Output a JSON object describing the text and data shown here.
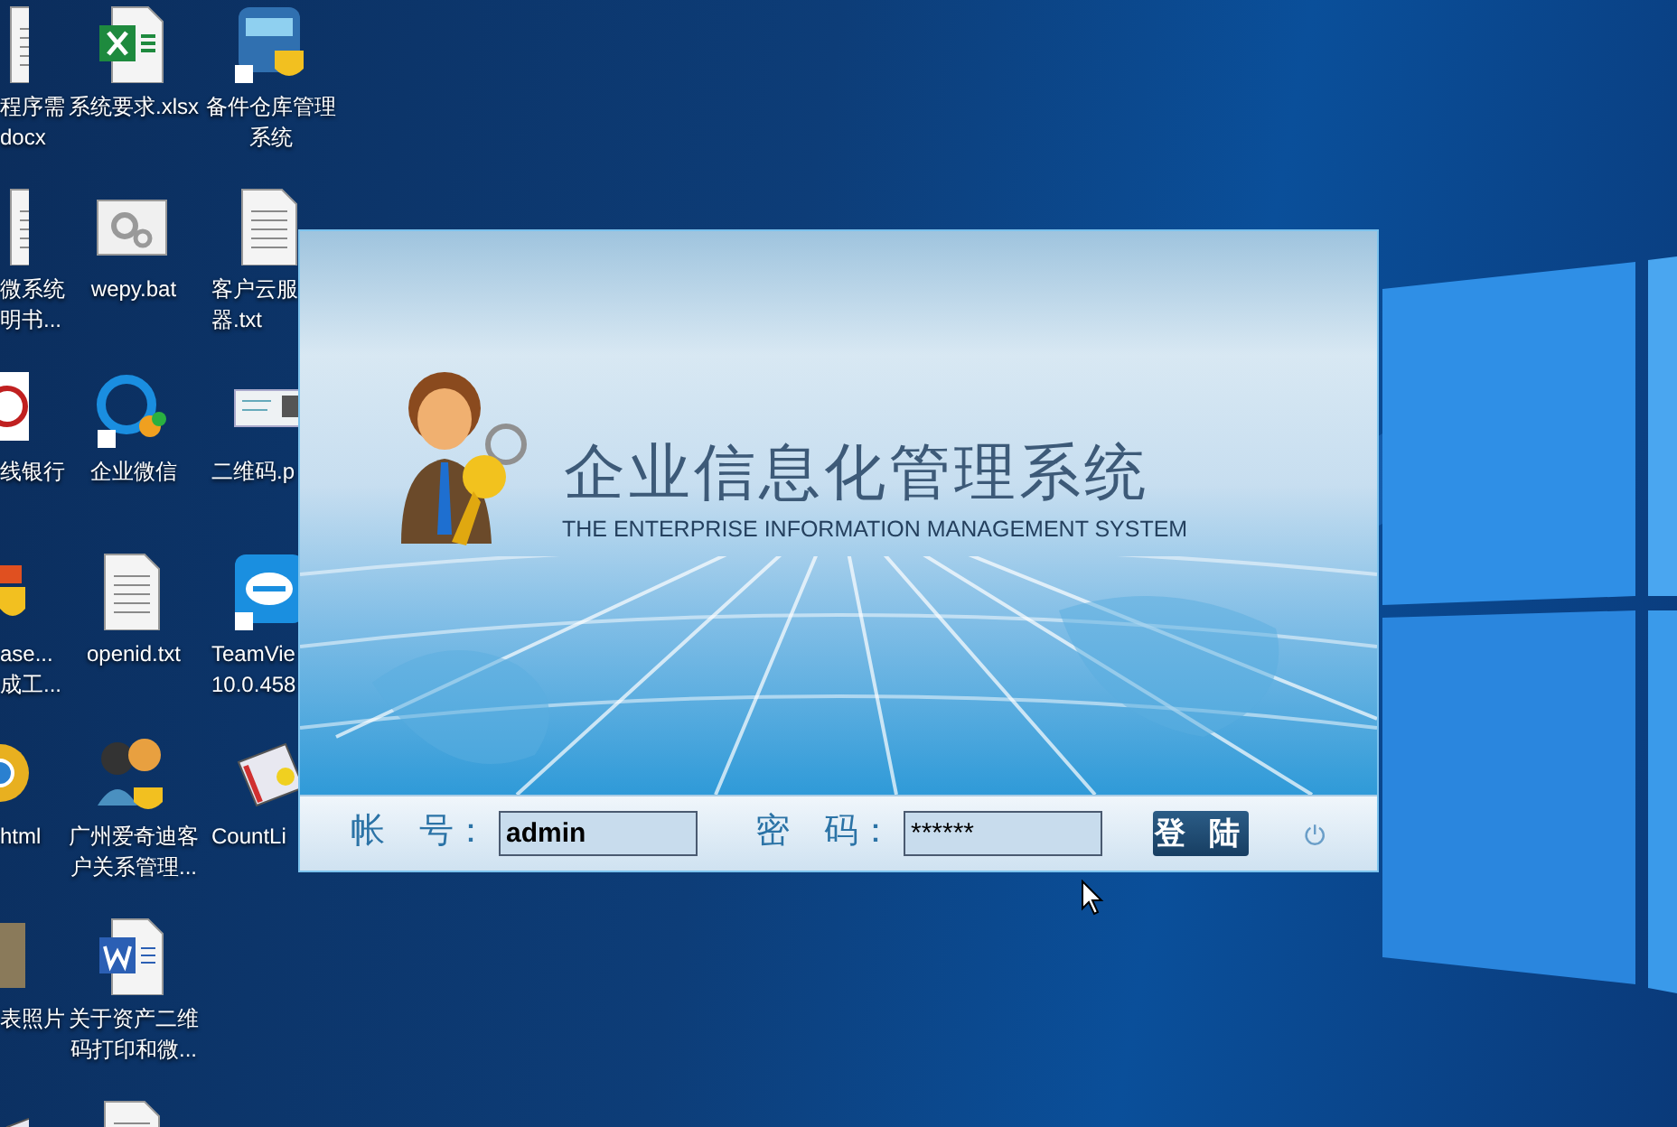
{
  "desktop": {
    "columns": [
      [
        {
          "kind": "doc",
          "label": [
            "程序需",
            "docx"
          ]
        },
        {
          "kind": "doc",
          "label": [
            "微系统",
            "明书..."
          ]
        },
        {
          "kind": "bank",
          "label": [
            "线银行"
          ]
        },
        {
          "kind": "shield",
          "label": [
            "ase...",
            "成工..."
          ]
        },
        {
          "kind": "browser",
          "label": [
            "html"
          ]
        },
        {
          "kind": "photo",
          "label": [
            "表照片"
          ]
        },
        {
          "kind": "tool"
        }
      ],
      [
        {
          "kind": "excel",
          "label": [
            "系统要求.xlsx"
          ]
        },
        {
          "kind": "bat",
          "label": [
            "wepy.bat"
          ]
        },
        {
          "kind": "chat",
          "label": [
            "企业微信"
          ]
        },
        {
          "kind": "doc",
          "label": [
            "openid.txt"
          ]
        },
        {
          "kind": "people",
          "label": [
            "广州爱奇迪客",
            "户关系管理..."
          ]
        },
        {
          "kind": "word",
          "label": [
            "关于资产二维",
            "码打印和微..."
          ]
        },
        {
          "kind": "doc"
        }
      ],
      [
        {
          "kind": "app",
          "label": [
            "备件仓库管理",
            "系统"
          ]
        },
        {
          "kind": "doc",
          "label": [
            "客户云服",
            "器.txt"
          ]
        },
        {
          "kind": "qr",
          "label": [
            "二维码.p"
          ]
        },
        {
          "kind": "remote",
          "label": [
            "TeamVie",
            "10.0.458"
          ]
        },
        {
          "kind": "tool",
          "label": [
            "CountLi"
          ]
        }
      ]
    ]
  },
  "dialog": {
    "title": "企业信息化管理系统",
    "subtitle": "THE ENTERPRISE INFORMATION MANAGEMENT SYSTEM",
    "account_label": "帐　号：",
    "account_value": "admin",
    "password_label": "密　码：",
    "password_value": "******",
    "login_button": "登 陆"
  }
}
